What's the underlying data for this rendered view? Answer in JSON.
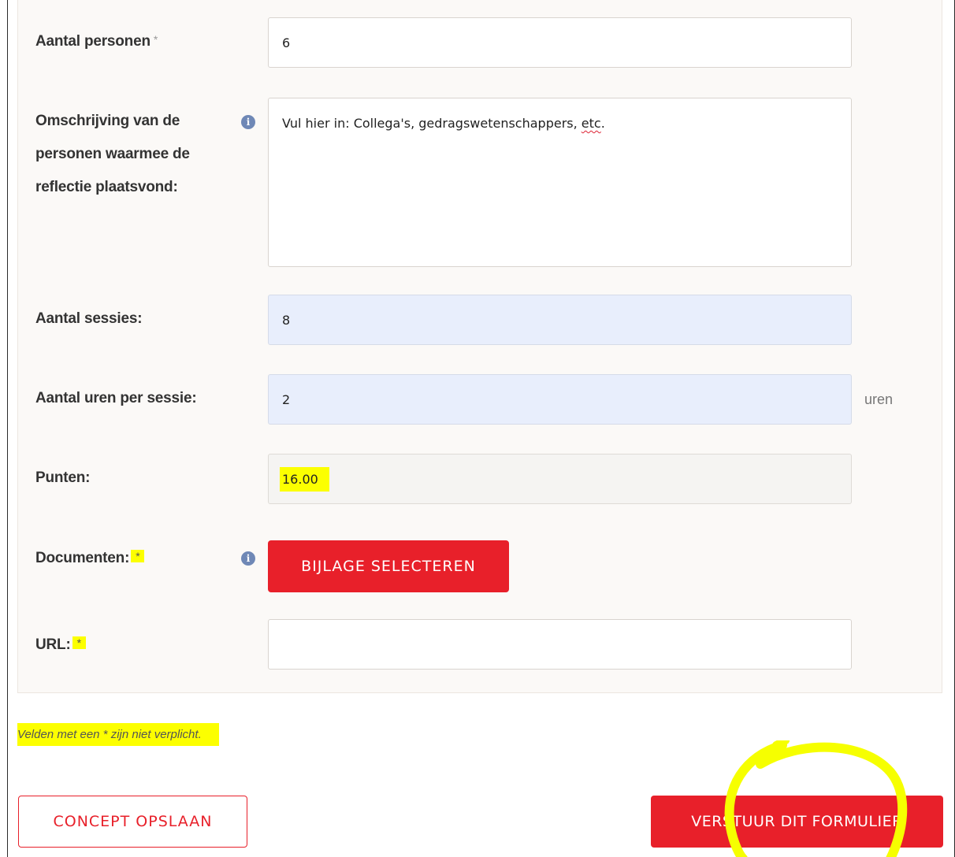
{
  "form": {
    "aantal_personen": {
      "label": "Aantal personen",
      "required_mark": "*",
      "value": "6"
    },
    "omschrijving": {
      "label_line1": "Omschrijving van de",
      "label_line2": "personen waarmee de",
      "label_line3": "reflectie plaatsvond:",
      "info_icon": "info-icon",
      "value_prefix": "Vul hier in: Collega's, gedragswetenschappers, ",
      "value_misspelled": "etc",
      "value_suffix": "."
    },
    "aantal_sessies": {
      "label": "Aantal sessies:",
      "value": "8"
    },
    "uren_per_sessie": {
      "label": "Aantal uren per sessie:",
      "value": "2",
      "unit": "uren"
    },
    "punten": {
      "label": "Punten:",
      "value": "16.00"
    },
    "documenten": {
      "label": "Documenten:",
      "required_mark": "*",
      "info_icon": "info-icon",
      "button_label": "BIJLAGE SELECTEREN"
    },
    "url": {
      "label": "URL:",
      "required_mark": "*",
      "value": ""
    }
  },
  "note": "Velden met een * zijn niet verplicht.",
  "actions": {
    "concept_label": "CONCEPT OPSLAAN",
    "submit_label": "VERSTUUR DIT FORMULIER"
  },
  "colors": {
    "accent": "#e8202a",
    "highlight": "#fcff00",
    "autofill": "#e8eefc"
  }
}
